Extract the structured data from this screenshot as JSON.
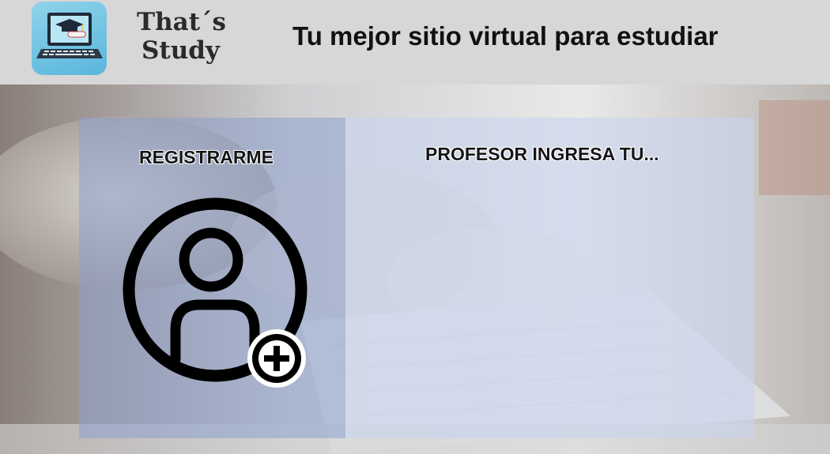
{
  "header": {
    "brand_line1": "That´s",
    "brand_line2": "Study",
    "tagline": "Tu mejor sitio virtual para estudiar"
  },
  "cards": {
    "register_title": "REGISTRARME",
    "teacher_title": "PROFESOR INGRESA TU..."
  },
  "icons": {
    "logo": "laptop-graduation-icon",
    "register": "add-user-icon"
  },
  "colors": {
    "header_bg": "#d7d7d7",
    "left_card": "#8ca0cd",
    "right_card": "#c8d4ee",
    "logo_bg": "#6cc0e2"
  }
}
